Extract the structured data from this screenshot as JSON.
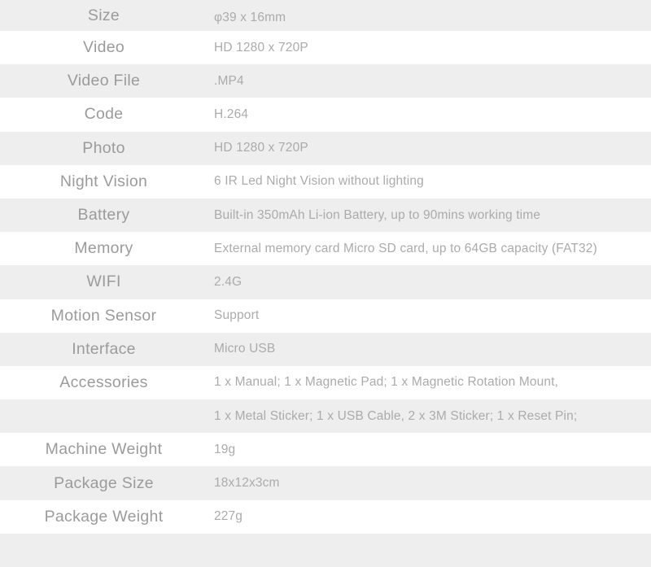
{
  "table": {
    "stripe_color_gray": "#eeeeee",
    "stripe_color_white": "#ffffff",
    "label_color": "#9b9b9b",
    "value_color": "#ababab",
    "rows": [
      {
        "label": "Size",
        "value": "φ39 x 16mm"
      },
      {
        "label": "Video",
        "value": "HD 1280 x 720P"
      },
      {
        "label": "Video File",
        "value": ".MP4"
      },
      {
        "label": "Code",
        "value": "H.264"
      },
      {
        "label": "Photo",
        "value": "HD 1280 x 720P"
      },
      {
        "label": "Night Vision",
        "value": "6 IR Led Night Vision without lighting"
      },
      {
        "label": "Battery",
        "value": "Built-in 350mAh Li-ion Battery, up to 90mins working time"
      },
      {
        "label": "Memory",
        "value": "External memory card Micro SD card, up to 64GB capacity (FAT32)"
      },
      {
        "label": "WIFI",
        "value": "2.4G"
      },
      {
        "label": "Motion Sensor",
        "value": "Support"
      },
      {
        "label": "Interface",
        "value": "Micro USB"
      },
      {
        "label": "Accessories",
        "value": "1 x Manual; 1 x Magnetic Pad; 1 x Magnetic Rotation Mount,"
      },
      {
        "label": "",
        "value": "1 x Metal Sticker; 1 x USB Cable, 2 x 3M Sticker; 1 x Reset Pin;"
      },
      {
        "label": "Machine Weight",
        "value": "19g"
      },
      {
        "label": "Package Size",
        "value": "18x12x3cm"
      },
      {
        "label": "Package Weight",
        "value": "227g"
      },
      {
        "label": "",
        "value": ""
      }
    ]
  }
}
